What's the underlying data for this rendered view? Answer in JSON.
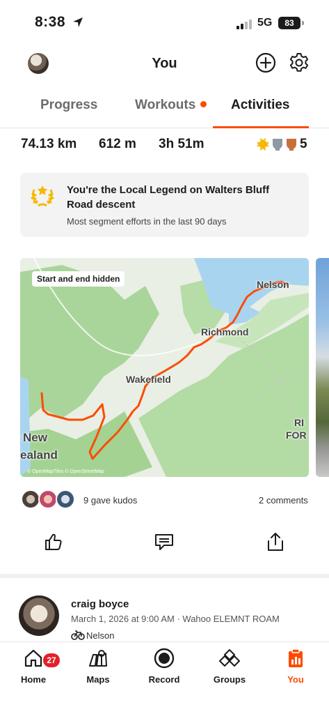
{
  "status_bar": {
    "time": "8:38",
    "network": "5G",
    "battery": "83"
  },
  "header": {
    "title": "You"
  },
  "tabs": [
    {
      "label": "Progress"
    },
    {
      "label": "Workouts"
    },
    {
      "label": "Activities"
    }
  ],
  "stats": {
    "distance": "74.13 km",
    "elevation": "612 m",
    "time": "3h 51m",
    "achievements_count": "5"
  },
  "local_legend": {
    "title": "You're the Local Legend on Walters Bluff Road descent",
    "subtitle": "Most segment efforts in the last 90 days"
  },
  "map": {
    "chip": "Start and end hidden",
    "labels": {
      "nelson": "Nelson",
      "richmond": "Richmond",
      "wakefield": "Wakefield",
      "new": "New",
      "zealand": "ealand",
      "ri": "RI",
      "for": "FOR"
    },
    "attribution": "© OpenMapTiles © OpenStreetMap"
  },
  "social": {
    "kudos": "9 gave kudos",
    "comments": "2 comments"
  },
  "post": {
    "name": "craig boyce",
    "meta": "March 1, 2026 at 9:00 AM · Wahoo ELEMNT ROAM",
    "location": "Nelson"
  },
  "tabbar": {
    "items": [
      {
        "label": "Home",
        "icon": "home-icon",
        "badge": "27"
      },
      {
        "label": "Maps",
        "icon": "map-icon"
      },
      {
        "label": "Record",
        "icon": "record-icon"
      },
      {
        "label": "Groups",
        "icon": "groups-icon"
      },
      {
        "label": "You",
        "icon": "you-icon"
      }
    ]
  },
  "colors": {
    "accent": "#fc4c02",
    "badge": "#e3202a",
    "route": "#fc4c02",
    "water": "#a9d4f0",
    "land": "#9fcd8e"
  }
}
